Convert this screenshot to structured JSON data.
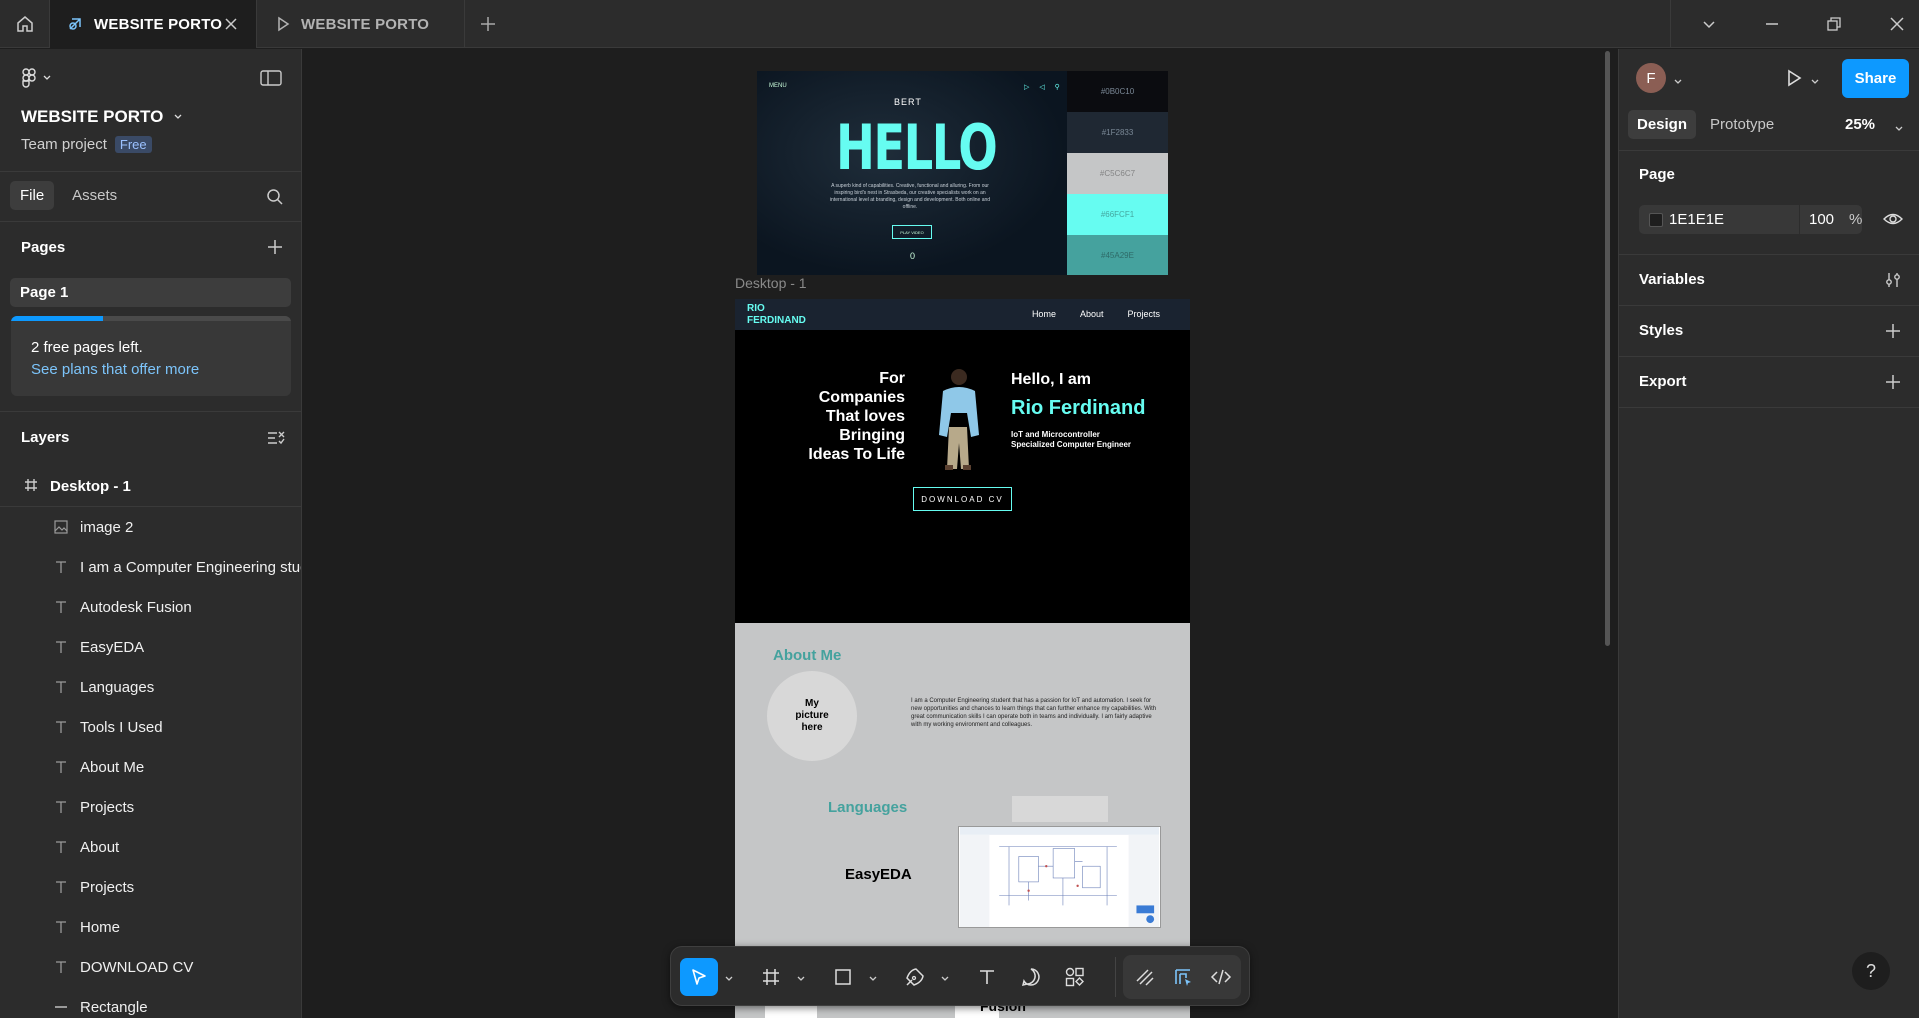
{
  "titlebar": {
    "tabs": [
      {
        "label": "WEBSITE PORTO"
      },
      {
        "label": "WEBSITE PORTO"
      }
    ]
  },
  "left_panel": {
    "project_name": "WEBSITE PORTO",
    "team": "Team project",
    "plan_badge": "Free",
    "tabs": {
      "file": "File",
      "assets": "Assets"
    },
    "pages_title": "Pages",
    "current_page": "Page 1",
    "upsell": {
      "line1": "2 free pages left.",
      "line2": "See plans that offer more",
      "progress": 0.33
    },
    "layers_title": "Layers",
    "frame": "Desktop - 1",
    "layers": [
      {
        "name": "image 2",
        "icon": "image-icon"
      },
      {
        "name": "I am a Computer Engineering student that has a passion for IoT and",
        "icon": "text-icon"
      },
      {
        "name": "Autodesk Fusion",
        "icon": "text-icon"
      },
      {
        "name": "EasyEDA",
        "icon": "text-icon"
      },
      {
        "name": "Languages",
        "icon": "text-icon"
      },
      {
        "name": "Tools I Used",
        "icon": "text-icon"
      },
      {
        "name": "About Me",
        "icon": "text-icon"
      },
      {
        "name": "Projects",
        "icon": "text-icon"
      },
      {
        "name": "About",
        "icon": "text-icon"
      },
      {
        "name": "Projects",
        "icon": "text-icon"
      },
      {
        "name": "Home",
        "icon": "text-icon"
      },
      {
        "name": "DOWNLOAD CV",
        "icon": "text-icon"
      },
      {
        "name": "Rectangle",
        "icon": "rectangle-icon"
      }
    ]
  },
  "canvas": {
    "shot": {
      "menu": "MENU",
      "logo": "BERT",
      "hello": "HELLO",
      "paragraph": "A superb kind of capabilities. Creative, functional and alluring. From our inspiring bird's nest in Strasbeda, our creative specialists work on an international level at branding, design and development. Both online and offline.",
      "play": "PLAY VIDEO",
      "counter": "0",
      "swatches": [
        {
          "label": "#0B0C10",
          "color": "#0b0c10"
        },
        {
          "label": "#1F2833",
          "color": "#1f2833"
        },
        {
          "label": "#C5C6C7",
          "color": "#c5c6c7"
        },
        {
          "label": "#66FCF1",
          "color": "#66fcf1"
        },
        {
          "label": "#45A29E",
          "color": "#45a29e"
        }
      ]
    },
    "frame_label": "Desktop - 1",
    "frame": {
      "brand_line1": "RIO",
      "brand_line2": "FERDINAND",
      "nav": [
        "Home",
        "About",
        "Projects"
      ],
      "tagline": [
        "For",
        "Companies",
        "That loves",
        "Bringing",
        "Ideas To Life"
      ],
      "hello": "Hello, I am",
      "name": "Rio Ferdinand",
      "role_line1": "IoT and Microcontroller",
      "role_line2": "Specialized Computer Engineer",
      "cv_button": "DOWNLOAD CV",
      "about_title": "About Me",
      "picture_placeholder": [
        "My",
        "picture",
        "here"
      ],
      "bio": "I am a Computer Engineering student that has a passion for IoT and automation. I seek for new opportunities and chances to learn things that can further enhance my capabilities. With great communication skills I can operate both in teams and individually. I am fairly adaptive with my working environment and colleagues.",
      "languages_title": "Languages",
      "easyeda": "EasyEDA",
      "fusion": "Fusion"
    }
  },
  "right_panel": {
    "avatar_initial": "F",
    "share": "Share",
    "tabs": {
      "design": "Design",
      "prototype": "Prototype"
    },
    "zoom": "25%",
    "page_title": "Page",
    "bg_hex": "1E1E1E",
    "bg_opacity": "100",
    "percent": "%",
    "variables": "Variables",
    "styles": "Styles",
    "export": "Export",
    "help": "?"
  },
  "colors": {
    "accent": "#0d99ff",
    "cyan": "#66fcf1",
    "teal": "#45a29e"
  }
}
